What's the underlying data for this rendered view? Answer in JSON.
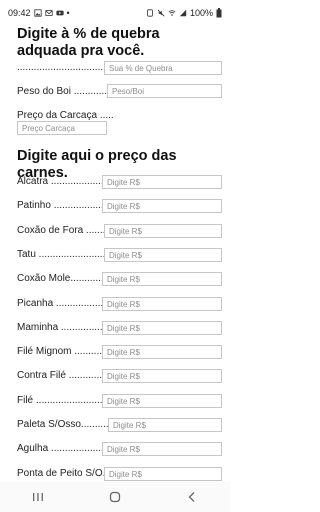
{
  "status": {
    "time": "09:42",
    "battery": "100%"
  },
  "section1": {
    "title": "Digite à % de quebra adquada pra você.",
    "quebra_dots": "......................................",
    "quebra_placeholder": "Sua % de Quebra",
    "peso_label": "Peso do Boi ..............",
    "peso_placeholder": "Peso/Boi",
    "carcaca_label": "Preço da Carcaça .....",
    "carcaca_placeholder": "Preço Carcaça"
  },
  "section2": {
    "title": "Digite aqui o preço das carnes.",
    "placeholder": "Digite R$",
    "items": [
      "Alcatra ......................",
      "Patinho .....................",
      "Coxão de Fora .........",
      "Tatu ............................",
      "Coxão Mole.............",
      "Picanha ......................",
      "Maminha ....................",
      "Filé Mignom .............",
      "Contra Filé ................",
      "Filé ..............................",
      "Paleta S/Osso...........",
      "Agulha .........................",
      "Ponta de Peito S/O..."
    ]
  }
}
